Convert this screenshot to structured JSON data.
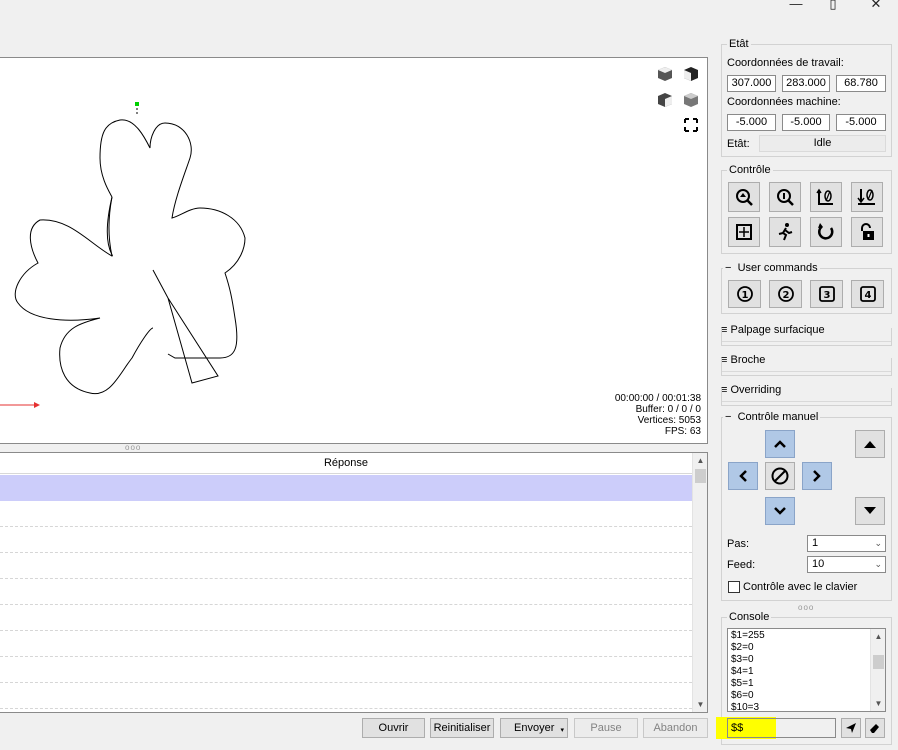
{
  "window": {
    "minimize": "—",
    "maximize": "▯",
    "close": "✕"
  },
  "visualizer": {
    "time": "00:00:00 / 00:01:38",
    "buffer": "Buffer: 0 / 0 / 0",
    "vertices": "Vertices: 5053",
    "fps": "FPS: 63"
  },
  "table": {
    "header": "Réponse",
    "row_count": 9
  },
  "toolbar": {
    "open": "Ouvrir",
    "reset": "Reinitialiser",
    "send": "Envoyer",
    "pause": "Pause",
    "abort": "Abandon"
  },
  "state": {
    "title": "Etât",
    "work_label": "Coordonnées de travail:",
    "work": [
      "307.000",
      "283.000",
      "68.780"
    ],
    "machine_label": "Coordonnées machine:",
    "machine": [
      "-5.000",
      "-5.000",
      "-5.000"
    ],
    "status_label": "Etât:",
    "status": "Idle"
  },
  "control": {
    "title": "Contrôle"
  },
  "user_commands": {
    "title": "User commands",
    "buttons": [
      "1",
      "2",
      "3",
      "4"
    ]
  },
  "sections": {
    "probe": "Palpage surfacique",
    "spindle": "Broche",
    "overriding": "Overriding"
  },
  "jog": {
    "title": "Contrôle manuel",
    "step_label": "Pas:",
    "step_value": "1",
    "feed_label": "Feed:",
    "feed_value": "10",
    "keyboard_label": "Contrôle avec le clavier"
  },
  "console": {
    "title": "Console",
    "lines": [
      "$1=255",
      "$2=0",
      "$3=0",
      "$4=1",
      "$5=1",
      "$6=0",
      "$10=3"
    ],
    "input_value": "$$"
  },
  "colors": {
    "selection": "#cccdfa",
    "highlight": "#ffff00",
    "jog_blue": "#b0c8e6"
  }
}
